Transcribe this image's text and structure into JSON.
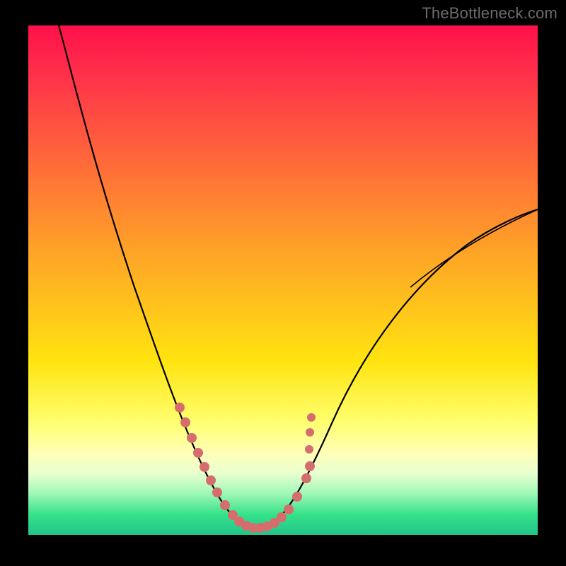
{
  "watermark": "TheBottleneck.com",
  "colors": {
    "top": "#ff1049",
    "mid": "#ffe40f",
    "bottom": "#22c48a",
    "curve": "#000000",
    "dots": "#d66d6d"
  },
  "chart_data": {
    "type": "line",
    "title": "",
    "xlabel": "",
    "ylabel": "",
    "xlim": [
      0,
      100
    ],
    "ylim": [
      0,
      100
    ],
    "grid": false,
    "legend": false,
    "series": [
      {
        "name": "bottleneck-curve",
        "x": [
          6,
          10,
          14,
          18,
          22,
          25,
          28,
          30,
          32,
          34,
          36,
          38,
          40,
          42,
          44,
          46,
          48,
          50,
          54,
          58,
          64,
          72,
          82,
          92,
          100
        ],
        "y": [
          100,
          88,
          76,
          64,
          52,
          42,
          34,
          28,
          22,
          16,
          11,
          7,
          4,
          2,
          1,
          1,
          2,
          4,
          8,
          14,
          22,
          32,
          44,
          54,
          62
        ]
      }
    ],
    "annotations": [
      {
        "name": "trough-markers",
        "style": "dots",
        "x": [
          29,
          30,
          31,
          32,
          33,
          34,
          35,
          37,
          39,
          40,
          41,
          42,
          43,
          44,
          45,
          46,
          47,
          48,
          50,
          52,
          53,
          54
        ],
        "y": [
          26,
          23,
          20,
          18,
          15,
          13,
          11,
          7,
          4,
          3,
          2,
          1.5,
          1,
          1,
          1,
          1.5,
          2,
          3,
          5,
          9,
          12,
          15
        ]
      }
    ]
  }
}
